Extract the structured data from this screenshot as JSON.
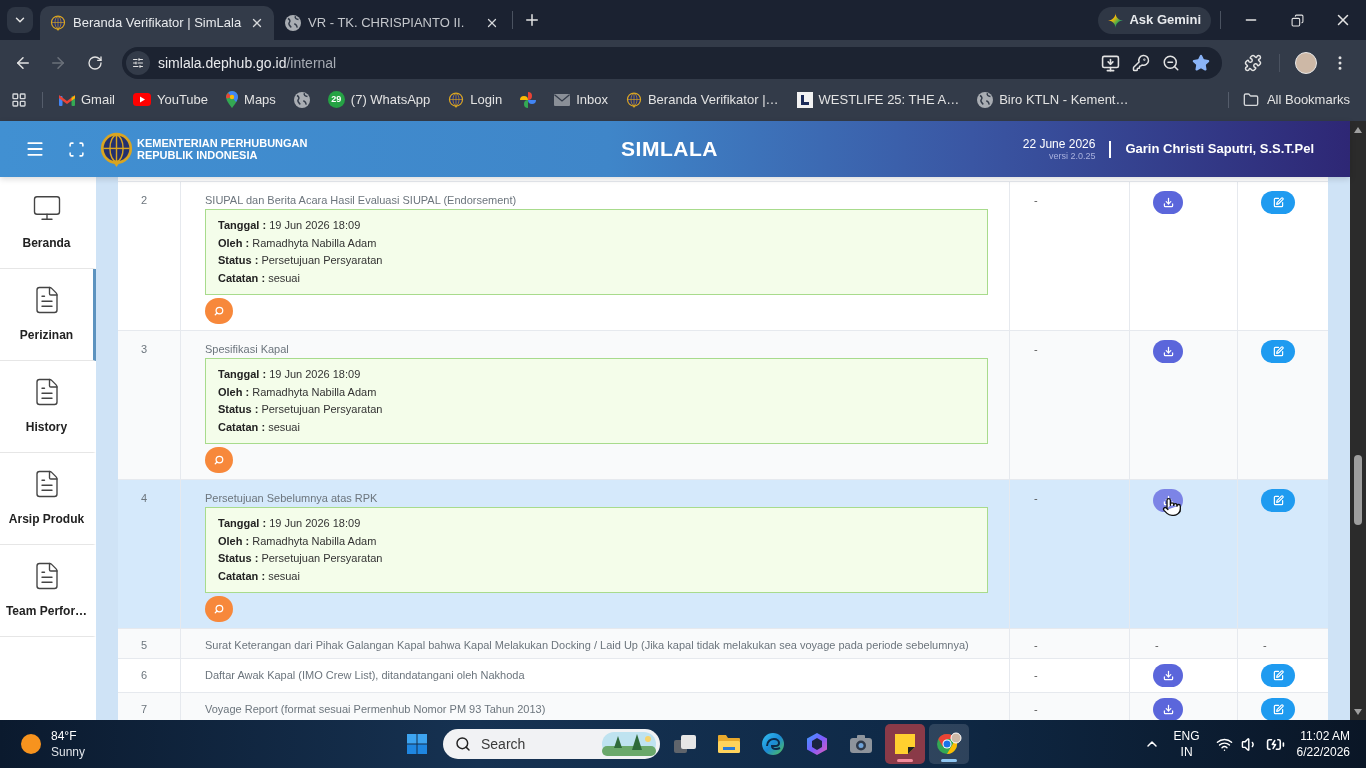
{
  "browser": {
    "tabs": [
      {
        "title": "Beranda Verifikator | SimLala",
        "kind": "emblem",
        "selected": true
      },
      {
        "title": "VR - TK. CHRISPIANTO II.",
        "kind": "globe",
        "selected": false
      }
    ],
    "ask_button": "Ask Gemini",
    "nav": {
      "forward_disabled": true
    },
    "address": {
      "host": "simlala.dephub.go.id",
      "path": "/internal",
      "bookmarked": true
    },
    "bookmarks": [
      {
        "kind": "gmail",
        "label": "Gmail"
      },
      {
        "kind": "youtube",
        "label": "YouTube"
      },
      {
        "kind": "maps",
        "label": "Maps"
      },
      {
        "kind": "globe"
      },
      {
        "kind": "whatsapp",
        "badge": "29",
        "label": "(7) WhatsApp"
      },
      {
        "kind": "emblem",
        "label": "Login"
      },
      {
        "kind": "pinwheel"
      },
      {
        "kind": "mail",
        "label": "Inbox"
      },
      {
        "kind": "emblem",
        "label": "Beranda Verifikator |…"
      },
      {
        "kind": "letter-box",
        "label": "WESTLIFE 25: THE A…"
      },
      {
        "kind": "globe",
        "label": "Biro KTLN - Kement…"
      }
    ],
    "all_bookmarks": "All Bookmarks"
  },
  "header": {
    "org": [
      "KEMENTERIAN PERHUBUNGAN",
      "REPUBLIK INDONESIA"
    ],
    "title": "SIMLALA",
    "date": "22 June 2026",
    "version": "versi 2.0.25",
    "user": "Garin Christi Saputri, S.S.T.Pel"
  },
  "sidebar": {
    "items": [
      {
        "kind": "monitor",
        "label": "Beranda",
        "selected": false
      },
      {
        "kind": "document",
        "label": "Perizinan",
        "selected": true
      },
      {
        "kind": "document",
        "label": "History",
        "selected": false
      },
      {
        "kind": "document",
        "label": "Arsip Produk",
        "selected": false
      },
      {
        "kind": "document",
        "label": "Team Perfor…",
        "selected": false
      }
    ]
  },
  "table": {
    "rows": [
      {
        "no": "2",
        "title": "SIUPAL dan Berita Acara Hasil Evaluasi SIUPAL (Endorsement)",
        "review": [
          {
            "label": "Tanggal :",
            "value": "19 Jun 2026 18:09"
          },
          {
            "label": "Oleh :",
            "value": "Ramadhyta Nabilla Adam"
          },
          {
            "label": "Status :",
            "value": "Persetujuan Persyaratan"
          },
          {
            "label": "Catatan :",
            "value": "sesuai"
          }
        ],
        "highlighted": false,
        "column_3": "-",
        "column_4": {
          "kind": "download",
          "hovered": false
        },
        "column_5": {
          "kind": "edit"
        }
      },
      {
        "no": "3",
        "title": "Spesifikasi Kapal",
        "review": [
          {
            "label": "Tanggal :",
            "value": "19 Jun 2026 18:09"
          },
          {
            "label": "Oleh :",
            "value": "Ramadhyta Nabilla Adam"
          },
          {
            "label": "Status :",
            "value": "Persetujuan Persyaratan"
          },
          {
            "label": "Catatan :",
            "value": "sesuai"
          }
        ],
        "highlighted": false,
        "column_3": "-",
        "column_4": {
          "kind": "download",
          "hovered": false
        },
        "column_5": {
          "kind": "edit"
        }
      },
      {
        "no": "4",
        "title": "Persetujuan Sebelumnya atas RPK",
        "review": [
          {
            "label": "Tanggal :",
            "value": "19 Jun 2026 18:09"
          },
          {
            "label": "Oleh :",
            "value": "Ramadhyta Nabilla Adam"
          },
          {
            "label": "Status :",
            "value": "Persetujuan Persyaratan"
          },
          {
            "label": "Catatan :",
            "value": "sesuai"
          }
        ],
        "highlighted": true,
        "column_3": "-",
        "column_4": {
          "kind": "download",
          "hovered": true
        },
        "column_5": {
          "kind": "edit"
        }
      },
      {
        "no": "5",
        "title": "Surat Keterangan dari Pihak Galangan Kapal bahwa Kapal Melakukan Docking / Laid Up (Jika kapal tidak melakukan sea voyage pada periode sebelumnya)",
        "highlighted": false,
        "column_3": "-",
        "column_4": {
          "kind": "text",
          "text": "-"
        },
        "column_5": {
          "kind": "text",
          "text": "-"
        }
      },
      {
        "no": "6",
        "title": "Daftar Awak Kapal (IMO Crew List), ditandatangani oleh Nakhoda",
        "highlighted": false,
        "column_3": "-",
        "column_4": {
          "kind": "download",
          "hovered": false
        },
        "column_5": {
          "kind": "edit"
        }
      },
      {
        "no": "7",
        "title": "Voyage Report (format sesuai Permenhub Nomor PM 93 Tahun 2013)",
        "highlighted": false,
        "column_3": "-",
        "column_4": {
          "kind": "download",
          "hovered": false
        },
        "column_5": {
          "kind": "edit"
        }
      }
    ]
  },
  "taskbar": {
    "weather": {
      "temp": "84°F",
      "condition": "Sunny"
    },
    "search": {
      "placeholder": "Search"
    },
    "apps": [
      {
        "kind": "task-view",
        "running": false,
        "flashing": false
      },
      {
        "kind": "folder",
        "running": false,
        "flashing": false
      },
      {
        "kind": "swirl",
        "running": false,
        "flashing": false
      },
      {
        "kind": "hexagon",
        "running": false,
        "flashing": false
      },
      {
        "kind": "camera",
        "running": false,
        "flashing": false
      },
      {
        "kind": "sticky-note",
        "running": true,
        "flashing": true
      },
      {
        "kind": "browser",
        "running": true,
        "flashing": false
      }
    ],
    "language": [
      "ENG",
      "IN"
    ],
    "time": "11:02 AM",
    "date": "6/22/2026"
  }
}
